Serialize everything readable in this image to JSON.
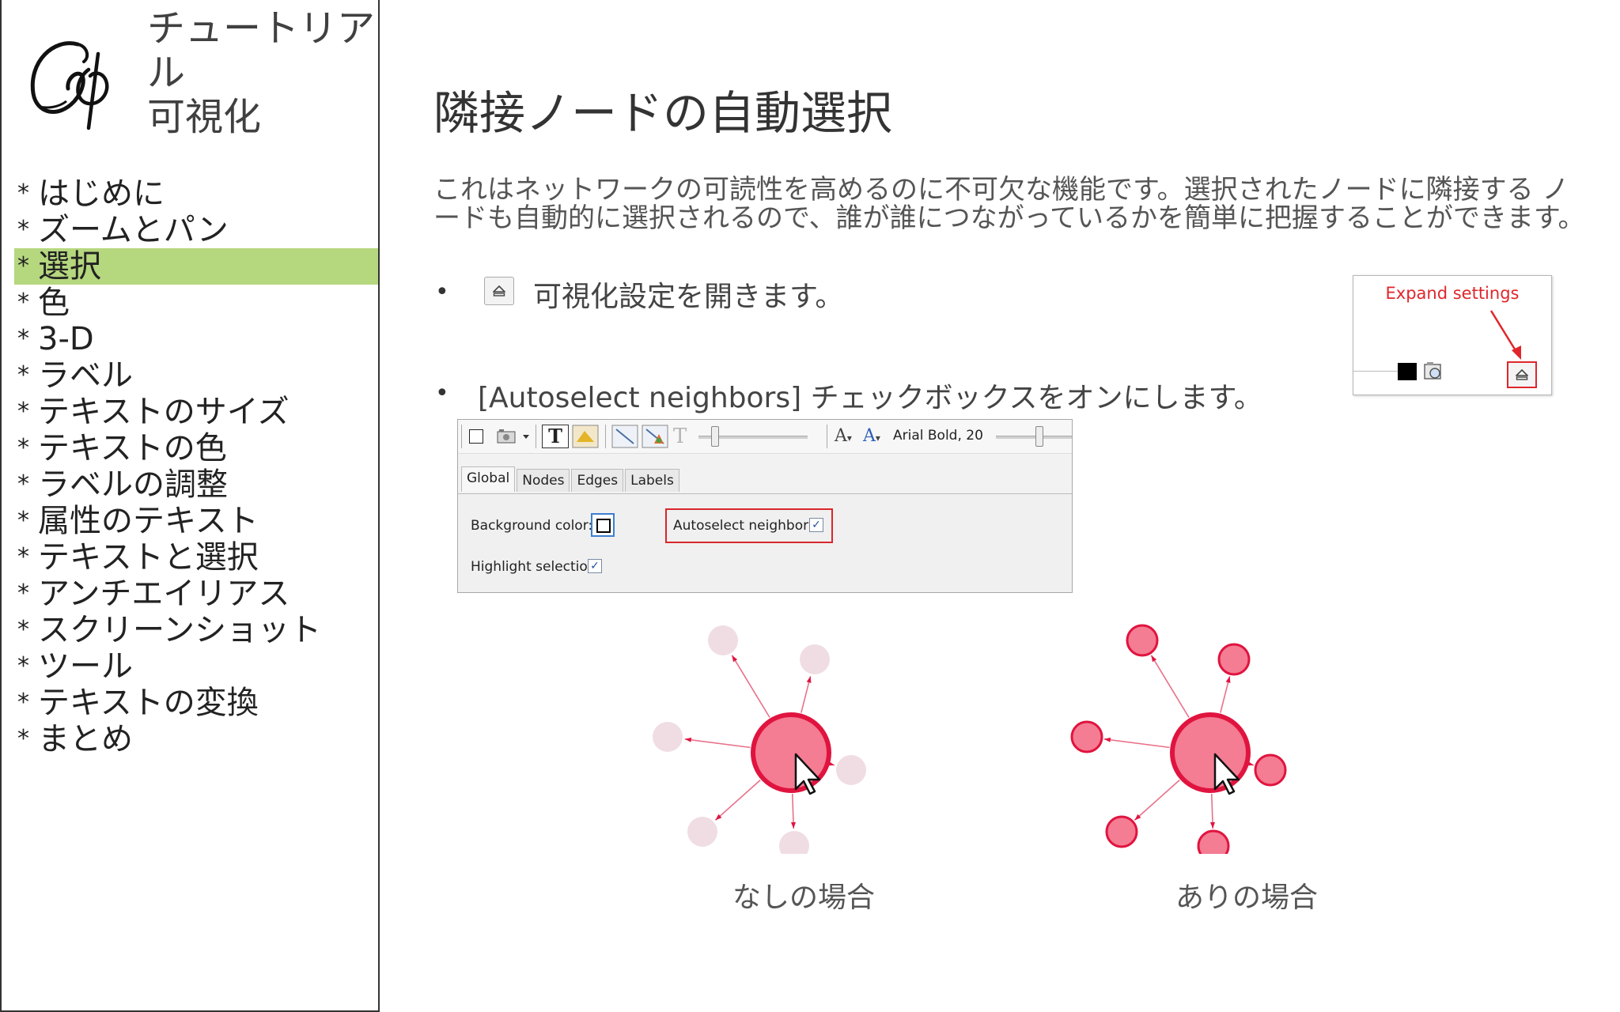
{
  "sidebar": {
    "title": "チュートリアル\n可視化",
    "items": [
      {
        "label": "はじめに",
        "active": false
      },
      {
        "label": "ズームとパン",
        "active": false
      },
      {
        "label": "選択",
        "active": true
      },
      {
        "label": "色",
        "active": false
      },
      {
        "label": "3-D",
        "active": false
      },
      {
        "label": "ラベル",
        "active": false
      },
      {
        "label": "テキストのサイズ",
        "active": false
      },
      {
        "label": "テキストの色",
        "active": false
      },
      {
        "label": "ラベルの調整",
        "active": false
      },
      {
        "label": "属性のテキスト",
        "active": false
      },
      {
        "label": "テキストと選択",
        "active": false
      },
      {
        "label": "アンチエイリアス",
        "active": false
      },
      {
        "label": "スクリーンショット",
        "active": false
      },
      {
        "label": "ツール",
        "active": false
      },
      {
        "label": "テキストの変換",
        "active": false
      },
      {
        "label": "まとめ",
        "active": false
      }
    ],
    "bullet": "*",
    "active_color": "#b5d77e"
  },
  "main": {
    "title": "隣接ノードの自動選択",
    "intro": "これはネットワークの可読性を高めるのに不可欠な機能です。選択されたノードに隣接する ノードも自動的に選択されるので、誰が誰につながっているかを簡単に把握することができます。",
    "steps": [
      {
        "bullet": "•",
        "text": "可視化設定を開きます。"
      },
      {
        "bullet": "•",
        "text": "[Autoselect neighbors] チェックボックスをオンにします。"
      }
    ],
    "callout": {
      "label": "Expand settings",
      "accent": "#e0262b"
    },
    "settings_panel": {
      "font_label": "Arial Bold, 20",
      "tabs": [
        "Global",
        "Nodes",
        "Edges",
        "Labels"
      ],
      "active_tab": "Global",
      "background_color_label": "Background color:",
      "autoselect_label": "Autoselect neighbor",
      "autoselect_checked": true,
      "highlight_label": "Highlight selection",
      "highlight_checked": true,
      "check_mark": "✓"
    },
    "graphs": {
      "without": {
        "caption": "なしの場合",
        "neighbors_highlighted": false
      },
      "with": {
        "caption": "ありの場合",
        "neighbors_highlighted": true
      },
      "node_color": "#f47c93",
      "node_border": "#e0143f",
      "faded_color": "#f0dde4"
    }
  }
}
